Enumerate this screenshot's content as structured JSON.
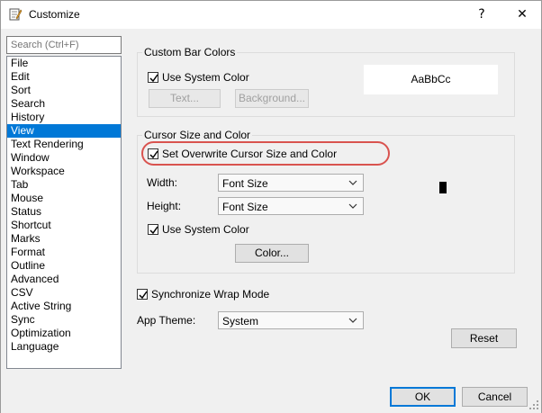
{
  "window": {
    "title": "Customize",
    "help_label": "?",
    "close_label": "✕"
  },
  "search": {
    "placeholder": "Search (Ctrl+F)"
  },
  "categories": [
    "File",
    "Edit",
    "Sort",
    "Search",
    "History",
    "View",
    "Text Rendering",
    "Window",
    "Workspace",
    "Tab",
    "Mouse",
    "Status",
    "Shortcut",
    "Marks",
    "Format",
    "Outline",
    "Advanced",
    "CSV",
    "Active String",
    "Sync",
    "Optimization",
    "Language"
  ],
  "selected_category": "View",
  "custom_bar_colors": {
    "title": "Custom Bar Colors",
    "use_system_color_label": "Use System Color",
    "use_system_color_checked": true,
    "text_button": "Text...",
    "background_button": "Background...",
    "preview_text": "AaBbCc"
  },
  "cursor_size_color": {
    "title": "Cursor Size and Color",
    "overwrite_label": "Set Overwrite Cursor Size and Color",
    "overwrite_checked": true,
    "width_label": "Width:",
    "width_value": "Font Size",
    "height_label": "Height:",
    "height_value": "Font Size",
    "use_system_color_label": "Use System Color",
    "use_system_color_checked": true,
    "color_button": "Color..."
  },
  "sync_wrap": {
    "label": "Synchronize Wrap Mode",
    "checked": true
  },
  "app_theme": {
    "label": "App Theme:",
    "value": "System"
  },
  "buttons": {
    "reset": "Reset",
    "ok": "OK",
    "cancel": "Cancel"
  },
  "colors": {
    "accent": "#0078d7",
    "highlight_ring": "#d9534f"
  }
}
